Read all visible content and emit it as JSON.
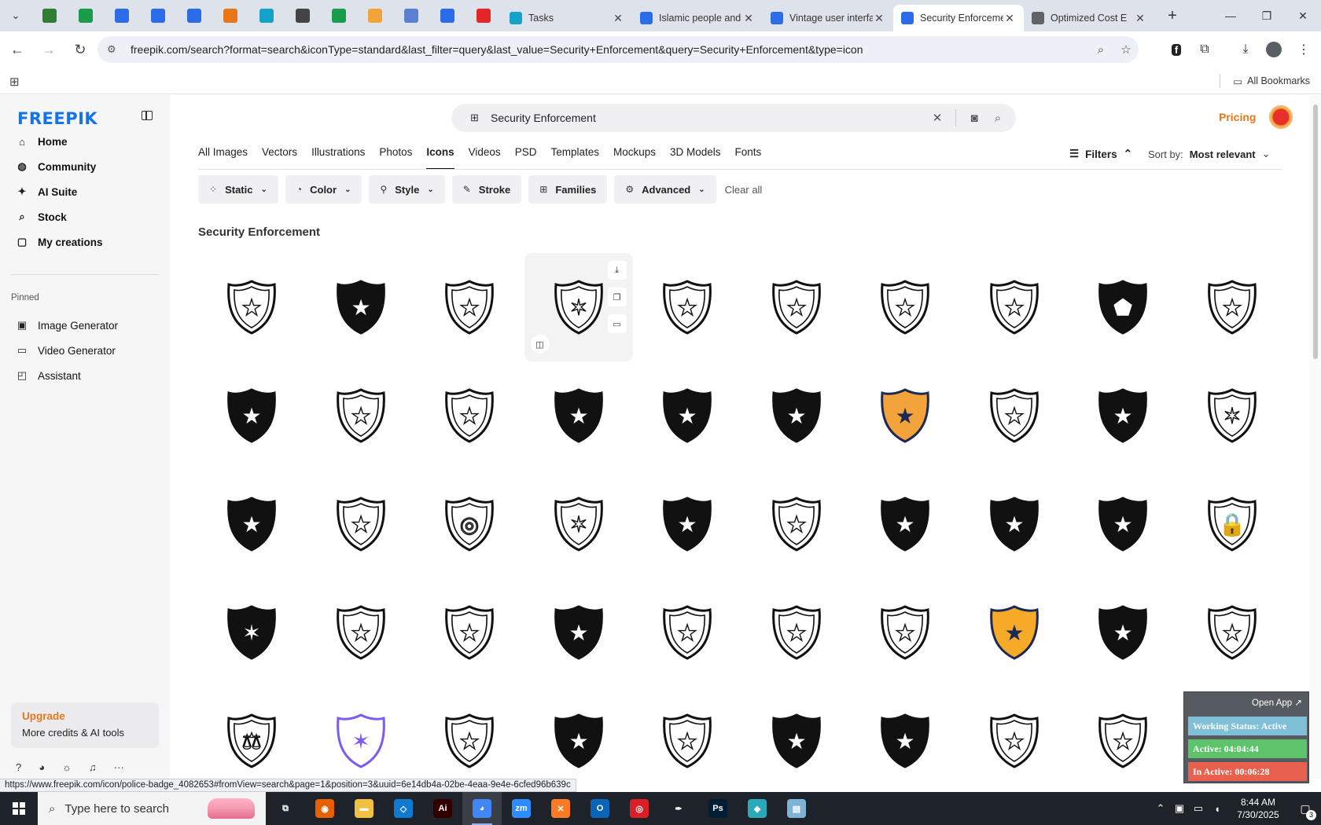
{
  "browser": {
    "pinned_tab_colors": [
      "#2e7d32",
      "#1a9d4b",
      "#2b6de8",
      "#2b6de8",
      "#2b6de8",
      "#e8771a",
      "#14a2c6",
      "#444444",
      "#1a9d4b",
      "#f2a33a",
      "#5b7fd1",
      "#2b6de8",
      "#e42525"
    ],
    "tabs": [
      {
        "label": "Tasks",
        "color": "#14a2c6",
        "active": false
      },
      {
        "label": "Islamic people and",
        "color": "#2b6de8",
        "active": false
      },
      {
        "label": "Vintage user interface",
        "color": "#2b6de8",
        "active": false
      },
      {
        "label": "Security Enforcement",
        "color": "#2b6de8",
        "active": true
      },
      {
        "label": "Optimized Cost E",
        "color": "#5f6368",
        "active": false
      }
    ],
    "url": "freepik.com/search?format=search&iconType=standard&last_filter=query&last_value=Security+Enforcement&query=Security+Enforcement&type=icon",
    "bookmarks_label": "All Bookmarks"
  },
  "sidebar": {
    "logo": "FREEPIK",
    "nav": [
      {
        "label": "Home",
        "icon": "home-icon",
        "glyph": "⌂"
      },
      {
        "label": "Community",
        "icon": "globe-icon",
        "glyph": "◍"
      },
      {
        "label": "AI Suite",
        "icon": "sparkle-icon",
        "glyph": "✦"
      },
      {
        "label": "Stock",
        "icon": "search-icon",
        "glyph": "⌕"
      },
      {
        "label": "My creations",
        "icon": "folder-icon",
        "glyph": "▢"
      }
    ],
    "pinned_label": "Pinned",
    "pinned": [
      {
        "label": "Image Generator",
        "icon": "image-icon",
        "glyph": "▣"
      },
      {
        "label": "Video Generator",
        "icon": "video-icon",
        "glyph": "▭"
      },
      {
        "label": "Assistant",
        "icon": "assistant-icon",
        "glyph": "◰"
      }
    ],
    "upgrade": {
      "title": "Upgrade",
      "subtitle": "More credits & AI tools"
    }
  },
  "search": {
    "value": "Security Enforcement"
  },
  "header": {
    "pricing": "Pricing"
  },
  "type_tabs": [
    "All Images",
    "Vectors",
    "Illustrations",
    "Photos",
    "Icons",
    "Videos",
    "PSD",
    "Templates",
    "Mockups",
    "3D Models",
    "Fonts"
  ],
  "active_type_tab": "Icons",
  "filters_label": "Filters",
  "sort": {
    "label": "Sort by:",
    "value": "Most relevant"
  },
  "chips": [
    {
      "label": "Static",
      "icon": "static-icon",
      "glyph": "⁘",
      "dropdown": true
    },
    {
      "label": "Color",
      "icon": "palette-icon",
      "glyph": "◔",
      "dropdown": true
    },
    {
      "label": "Style",
      "icon": "brush-icon",
      "glyph": "⚲",
      "dropdown": true
    },
    {
      "label": "Stroke",
      "icon": "pen-icon",
      "glyph": "✎",
      "dropdown": false
    },
    {
      "label": "Families",
      "icon": "grid-icon",
      "glyph": "⊞",
      "dropdown": false
    },
    {
      "label": "Advanced",
      "icon": "settings-icon",
      "glyph": "⚙",
      "dropdown": true
    }
  ],
  "clear_all": "Clear all",
  "results_title": "Security Enforcement",
  "icons": [
    {
      "style": "outline",
      "glyph": "★",
      "colored": false
    },
    {
      "style": "solid",
      "glyph": "★",
      "colored": false
    },
    {
      "style": "outline",
      "glyph": "★",
      "colored": false
    },
    {
      "style": "outline",
      "glyph": "✶",
      "colored": false
    },
    {
      "style": "outline",
      "glyph": "★",
      "colored": false
    },
    {
      "style": "outline",
      "glyph": "★",
      "colored": false
    },
    {
      "style": "outline",
      "glyph": "★",
      "colored": false
    },
    {
      "style": "outline",
      "glyph": "★",
      "colored": false
    },
    {
      "style": "solid",
      "glyph": "⬟",
      "colored": false
    },
    {
      "style": "outline",
      "glyph": "★",
      "colored": false
    },
    {
      "style": "solid",
      "glyph": "★",
      "colored": false
    },
    {
      "style": "outline",
      "glyph": "★",
      "colored": false
    },
    {
      "style": "outline",
      "glyph": "★",
      "colored": false
    },
    {
      "style": "solid",
      "glyph": "★",
      "colored": false
    },
    {
      "style": "solid",
      "glyph": "★",
      "colored": false
    },
    {
      "style": "solid",
      "glyph": "★",
      "colored": false
    },
    {
      "style": "color",
      "glyph": "★",
      "colored": true,
      "color": "#f2a33a"
    },
    {
      "style": "outline",
      "glyph": "★",
      "colored": false
    },
    {
      "style": "solid",
      "glyph": "★",
      "colored": false
    },
    {
      "style": "outline",
      "glyph": "✶",
      "colored": false
    },
    {
      "style": "solid",
      "glyph": "★",
      "colored": false
    },
    {
      "style": "outline",
      "glyph": "★",
      "colored": false
    },
    {
      "style": "outline",
      "glyph": "◎",
      "colored": false
    },
    {
      "style": "outline",
      "glyph": "✶",
      "colored": false
    },
    {
      "style": "solid",
      "glyph": "★",
      "colored": false
    },
    {
      "style": "outline",
      "glyph": "★",
      "colored": false
    },
    {
      "style": "solid",
      "glyph": "★",
      "colored": false
    },
    {
      "style": "solid",
      "glyph": "★",
      "colored": false
    },
    {
      "style": "solid",
      "glyph": "★",
      "colored": false
    },
    {
      "style": "outline",
      "glyph": "🔒",
      "colored": false
    },
    {
      "style": "solid",
      "glyph": "✶",
      "colored": false
    },
    {
      "style": "outline",
      "glyph": "★",
      "colored": false
    },
    {
      "style": "outline",
      "glyph": "★",
      "colored": false
    },
    {
      "style": "solid",
      "glyph": "★",
      "colored": false
    },
    {
      "style": "outline",
      "glyph": "★",
      "colored": false
    },
    {
      "style": "outline",
      "glyph": "★",
      "colored": false
    },
    {
      "style": "outline",
      "glyph": "★",
      "colored": false
    },
    {
      "style": "color",
      "glyph": "★",
      "colored": true,
      "color": "#f7a928"
    },
    {
      "style": "solid",
      "glyph": "★",
      "colored": false
    },
    {
      "style": "outline",
      "glyph": "★",
      "colored": false
    },
    {
      "style": "outline",
      "glyph": "⚖",
      "colored": false
    },
    {
      "style": "gradient",
      "glyph": "✶",
      "colored": true,
      "color": "#7b5cf0"
    },
    {
      "style": "outline",
      "glyph": "★",
      "colored": false
    },
    {
      "style": "solid",
      "glyph": "★",
      "colored": false
    },
    {
      "style": "outline",
      "glyph": "★",
      "colored": false
    },
    {
      "style": "solid",
      "glyph": "★",
      "colored": false
    },
    {
      "style": "solid",
      "glyph": "★",
      "colored": false
    },
    {
      "style": "outline",
      "glyph": "★",
      "colored": false
    },
    {
      "style": "outline",
      "glyph": "★",
      "colored": false
    },
    {
      "style": "outline",
      "glyph": "◎",
      "colored": false
    }
  ],
  "widget": {
    "open_app": "Open App ↗",
    "working_status": "Working Status: Active",
    "active": "Active: 04:04:44",
    "inactive": "In Active: 00:06:28"
  },
  "status_url": "https://www.freepik.com/icon/police-badge_4082653#fromView=search&page=1&position=3&uuid=6e14db4a-02be-4eaa-9e4e-6cfed96b639c",
  "taskbar": {
    "search_placeholder": "Type here to search",
    "apps": [
      {
        "name": "task-view",
        "label": "⧉",
        "color": "#1e2229"
      },
      {
        "name": "firefox",
        "label": "◉",
        "color": "#e66000"
      },
      {
        "name": "file-explorer",
        "label": "▬",
        "color": "#f0c040"
      },
      {
        "name": "vscode",
        "label": "◇",
        "color": "#0e7ad1"
      },
      {
        "name": "illustrator",
        "label": "Ai",
        "color": "#330000"
      },
      {
        "name": "chrome",
        "label": "◕",
        "color": "#4285f4"
      },
      {
        "name": "zoom",
        "label": "zm",
        "color": "#2d8cff"
      },
      {
        "name": "xampp",
        "label": "✕",
        "color": "#fb7a24"
      },
      {
        "name": "outlook",
        "label": "O",
        "color": "#0a64b8"
      },
      {
        "name": "creative-cloud",
        "label": "◎",
        "color": "#da1f26"
      },
      {
        "name": "pen-tool",
        "label": "✒",
        "color": "#1e2229"
      },
      {
        "name": "photoshop",
        "label": "Ps",
        "color": "#001e36"
      },
      {
        "name": "gem-app",
        "label": "◆",
        "color": "#2aa9b8"
      },
      {
        "name": "notes-app",
        "label": "▤",
        "color": "#7fb3d5"
      }
    ],
    "time": "8:44 AM",
    "date": "7/30/2025",
    "notifications": "3"
  }
}
